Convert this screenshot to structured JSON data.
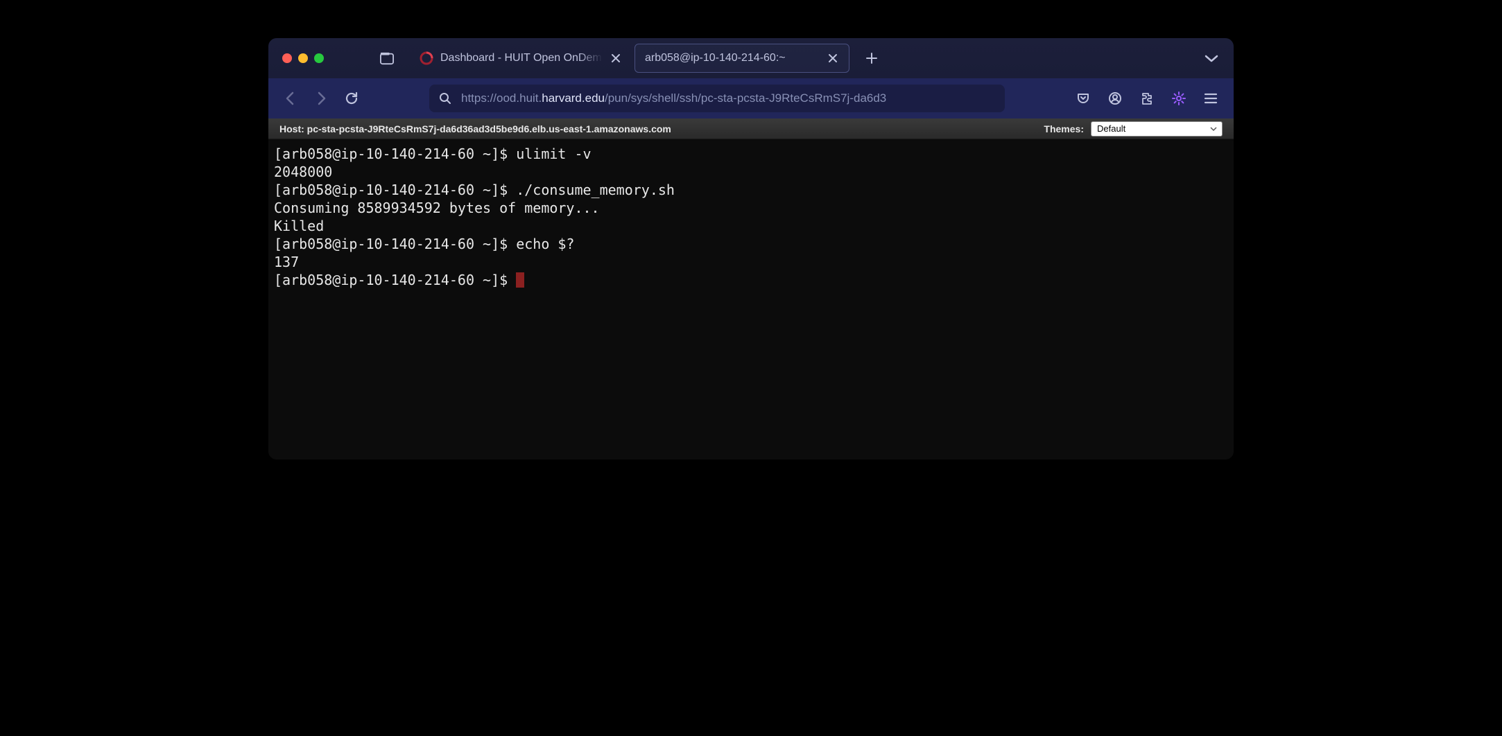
{
  "tabs": [
    {
      "title": "Dashboard - HUIT Open OnDemand",
      "active": false
    },
    {
      "title": "arb058@ip-10-140-214-60:~",
      "active": true
    }
  ],
  "url": {
    "prefix": "https://ood.huit.",
    "highlight": "harvard.edu",
    "suffix": "/pun/sys/shell/ssh/pc-sta-pcsta-J9RteCsRmS7j-da6d3"
  },
  "hostbar": {
    "label": "Host:",
    "host": "pc-sta-pcsta-J9RteCsRmS7j-da6d36ad3d5be9d6.elb.us-east-1.amazonaws.com",
    "themes_label": "Themes:",
    "theme_selected": "Default"
  },
  "terminal": {
    "lines": [
      "[arb058@ip-10-140-214-60 ~]$ ulimit -v",
      "2048000",
      "[arb058@ip-10-140-214-60 ~]$ ./consume_memory.sh",
      "Consuming 8589934592 bytes of memory...",
      "Killed",
      "[arb058@ip-10-140-214-60 ~]$ echo $?",
      "137"
    ],
    "prompt": "[arb058@ip-10-140-214-60 ~]$ "
  }
}
